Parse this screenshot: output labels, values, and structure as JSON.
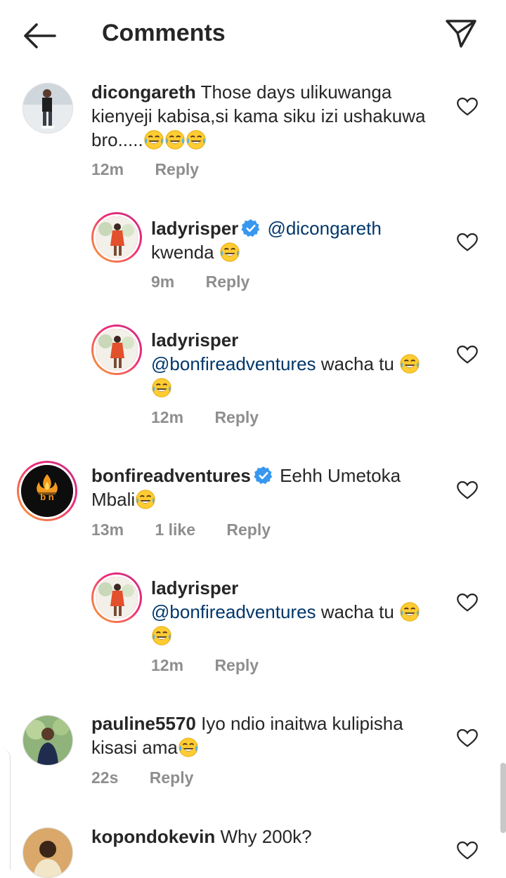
{
  "header": {
    "title": "Comments"
  },
  "comments": [
    {
      "username": "dicongareth",
      "text": "Those days ulikuwanga kienyeji kabisa,si kama siku izi ushakuwa bro.....",
      "emoji_count": 3,
      "time": "12m",
      "reply": "Reply"
    },
    {
      "username": "ladyrisper",
      "verified": true,
      "mention": "@dicongareth",
      "text": "kwenda",
      "time": "9m",
      "reply": "Reply"
    },
    {
      "username": "ladyrisper",
      "mention": "@bonfireadventures",
      "text": "wacha tu",
      "time": "12m",
      "reply": "Reply"
    },
    {
      "username": "bonfireadventures",
      "verified": true,
      "text": "Eehh Umetoka Mbali",
      "time": "13m",
      "likes": "1 like",
      "reply": "Reply"
    },
    {
      "username": "ladyrisper",
      "mention": "@bonfireadventures",
      "text": "wacha tu",
      "time": "12m",
      "reply": "Reply"
    },
    {
      "username": "pauline5570",
      "text": "Iyo ndio inaitwa kulipisha kisasi ama",
      "time": "22s",
      "reply": "Reply"
    },
    {
      "username": "kopondokevin",
      "text": "Why 200k?"
    }
  ],
  "icons": {
    "back": "arrow-left-icon",
    "share": "paper-plane-icon",
    "like": "heart-outline-icon",
    "verified": "verified-badge-icon",
    "emoji": "face-with-tears-of-joy-icon"
  },
  "colors": {
    "text": "#262626",
    "secondary": "#8e8e8e",
    "mention": "#00376b",
    "verified": "#3897f0",
    "story_ring_start": "#f9a532",
    "story_ring_end": "#c13584"
  }
}
